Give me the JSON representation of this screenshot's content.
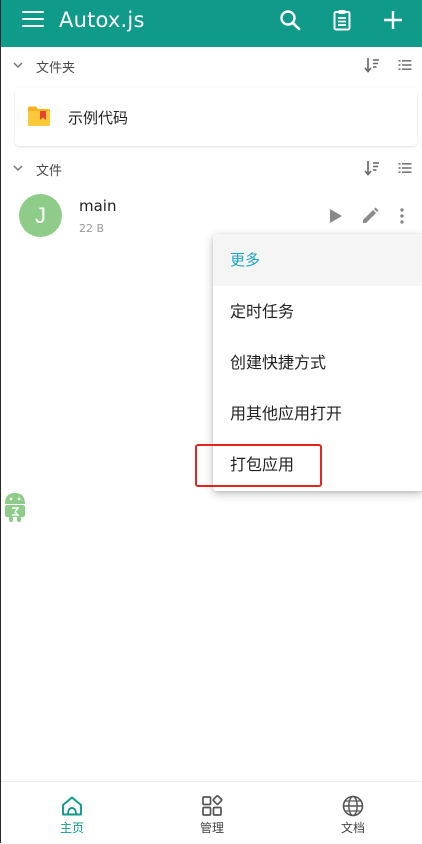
{
  "appbar": {
    "title": "Autox.js",
    "actions": [
      "search-icon",
      "clipboard-icon",
      "add-icon"
    ]
  },
  "sections": {
    "folders": {
      "label": "文件夹"
    },
    "files": {
      "label": "文件"
    }
  },
  "folders": [
    {
      "name": "示例代码"
    }
  ],
  "files": [
    {
      "avatar_letter": "J",
      "name": "main",
      "size": "22 B"
    }
  ],
  "popup_menu": {
    "header": "更多",
    "items": [
      "定时任务",
      "创建快捷方式",
      "用其他应用打开",
      "打包应用"
    ]
  },
  "bottom_nav": {
    "home": "主页",
    "manage": "管理",
    "docs": "文档"
  },
  "colors": {
    "primary": "#0f9a8a",
    "accent": "#1aa4c8",
    "highlight": "#e52420",
    "avatar": "#8fcc8a"
  }
}
